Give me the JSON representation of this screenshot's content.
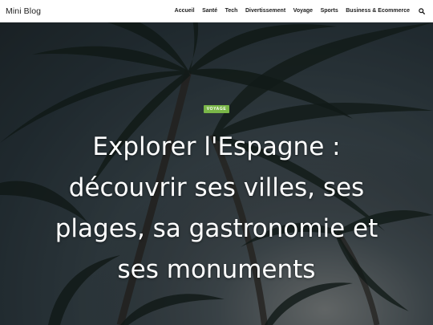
{
  "header": {
    "site_title": "Mini Blog",
    "nav": [
      {
        "label": "Accueil"
      },
      {
        "label": "Santé"
      },
      {
        "label": "Tech"
      },
      {
        "label": "Divertissement"
      },
      {
        "label": "Voyage"
      },
      {
        "label": "Sports"
      },
      {
        "label": "Business & Ecommerce"
      }
    ],
    "search_icon": "search-icon"
  },
  "hero": {
    "category": "VOYAGE",
    "title": "Explorer l'Espagne : découvrir ses villes, ses plages, sa gastronomie et ses monuments",
    "background": "palm-trees-dusk-sky"
  },
  "colors": {
    "accent": "#7ab648",
    "header_bg": "#ffffff",
    "title_text": "#ffffff"
  }
}
